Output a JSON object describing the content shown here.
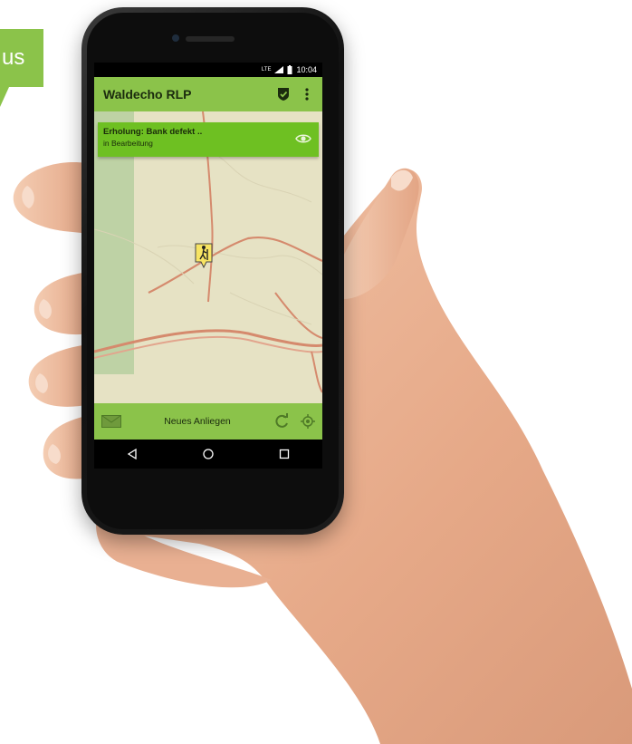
{
  "badge": {
    "text": "us"
  },
  "status_bar": {
    "network": "LTE",
    "time": "10:04"
  },
  "app_bar": {
    "title": "Waldecho RLP",
    "icons": [
      "shield-check-icon",
      "more-vert-icon"
    ]
  },
  "issue_card": {
    "title": "Erholung: Bank defekt ..",
    "status": "in Bearbeitung",
    "icon": "eye-icon"
  },
  "map": {
    "marker_icon": "hiker-icon"
  },
  "bottom_bar": {
    "label": "Neues Anliegen",
    "icons": [
      "mail-icon",
      "refresh-icon",
      "locate-icon"
    ]
  },
  "nav_bar": {
    "icons": [
      "back-icon",
      "home-icon",
      "recents-icon"
    ]
  },
  "colors": {
    "accent": "#8bc34a",
    "card": "#6ec022",
    "marker": "#f7e463"
  }
}
